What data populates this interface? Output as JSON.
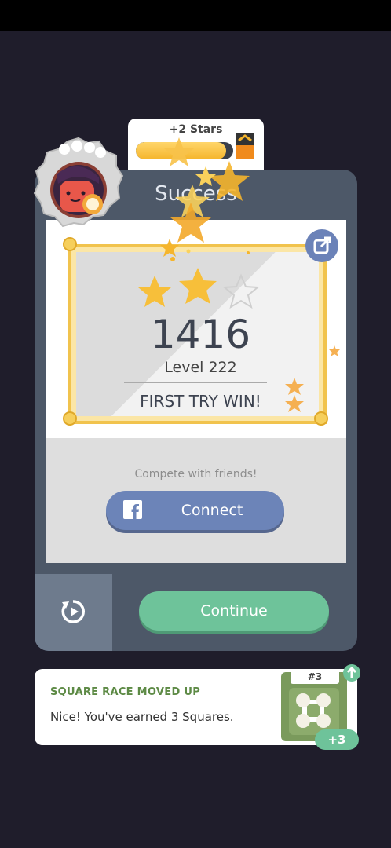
{
  "reward": {
    "stars_label": "+2 Stars",
    "progress_fraction": 0.93
  },
  "card": {
    "title": "Success",
    "score": "1416",
    "level": "Level 222",
    "result": "FIRST TRY WIN!",
    "stars_earned": 2,
    "stars_total": 3,
    "compete_text": "Compete with friends!",
    "connect_label": "Connect",
    "continue_label": "Continue"
  },
  "notification": {
    "title": "SQUARE RACE MOVED UP",
    "message": "Nice! You've earned 3 Squares.",
    "rank": "#3",
    "bonus": "+3"
  },
  "colors": {
    "background": "#1f1d2b",
    "card": "#4d5868",
    "accent_green": "#6ec39a",
    "facebook": "#6c84b8",
    "gold": "#f1c34d"
  },
  "icons": [
    "chest-icon",
    "share-icon",
    "facebook-icon",
    "replay-icon",
    "up-arrow-icon",
    "square-race-icon"
  ]
}
